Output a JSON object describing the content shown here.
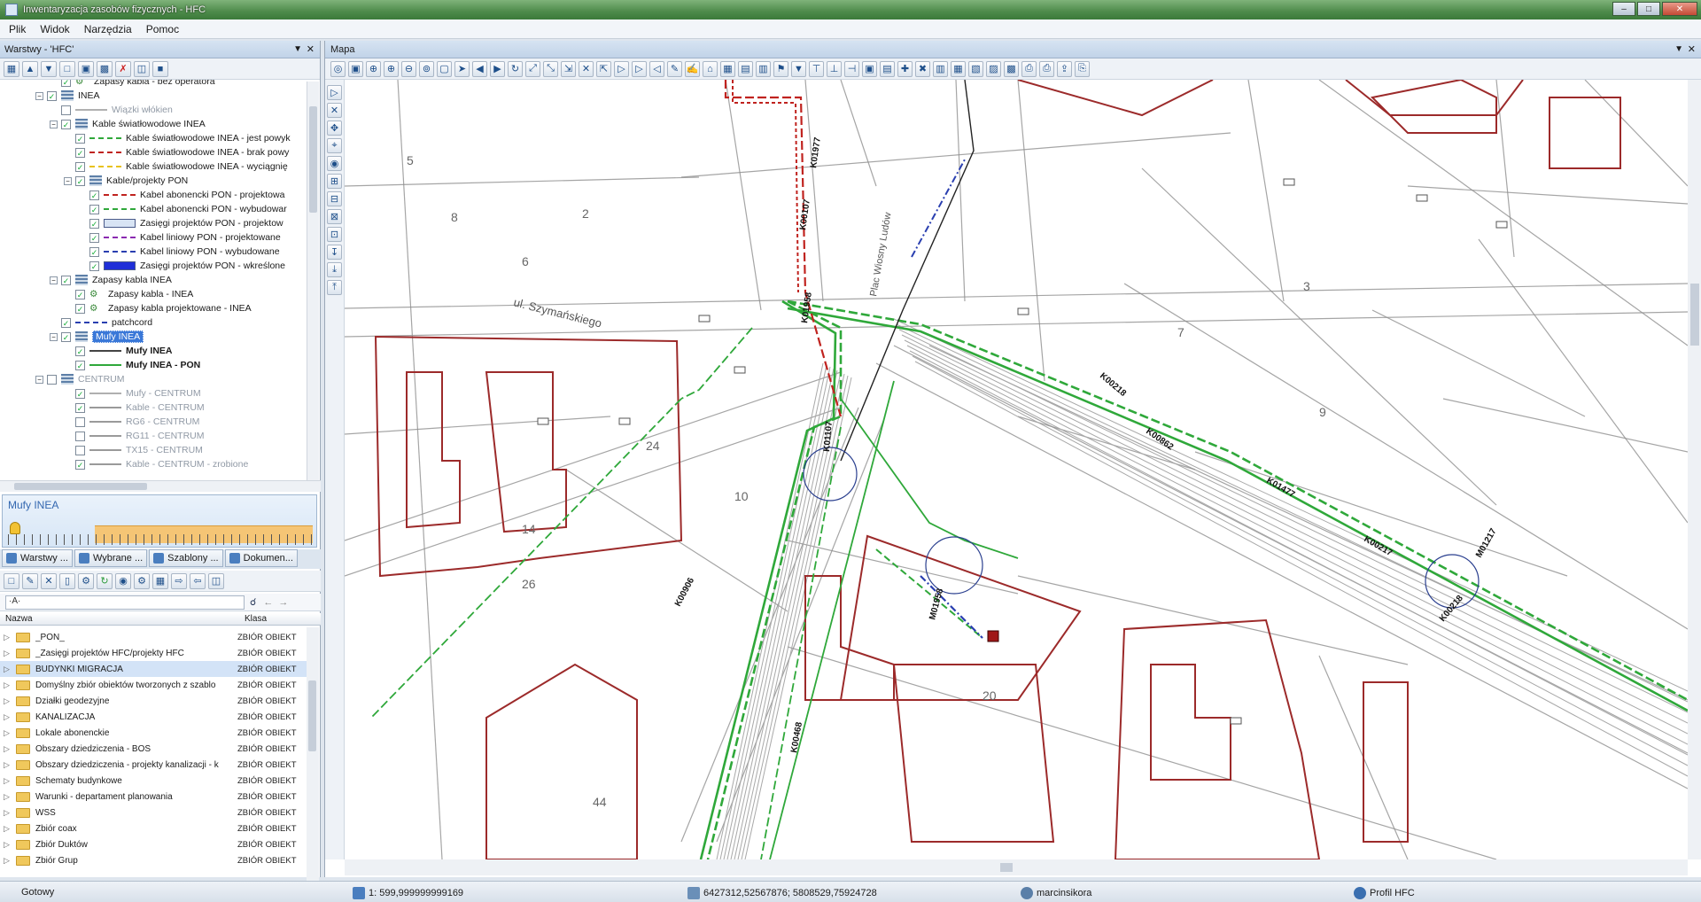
{
  "window": {
    "title": "Inwentaryzacja zasobów fizycznych - HFC"
  },
  "menu": [
    "Plik",
    "Widok",
    "Narzędzia",
    "Pomoc"
  ],
  "layers_panel": {
    "title": "Warstwy - 'HFC'",
    "items": [
      {
        "label": "Zapasy kabla - bez operatora",
        "level": 3,
        "type": "layer",
        "checked": true,
        "grey": false
      },
      {
        "label": "INEA",
        "level": 2,
        "type": "group",
        "checked": true,
        "grey": false
      },
      {
        "label": "Wiązki włókien",
        "level": 3,
        "type": "layer",
        "checked": false,
        "grey": true,
        "sym": "#b0b0b0",
        "dash": "solid"
      },
      {
        "label": "Kable światłowodowe INEA",
        "level": 3,
        "type": "group",
        "checked": true,
        "grey": false
      },
      {
        "label": "Kable światłowodowe INEA - jest powyk",
        "level": 4,
        "type": "layer",
        "checked": true,
        "grey": false,
        "sym": "#2fa83a",
        "dash": "dashed"
      },
      {
        "label": "Kable światłowodowe INEA - brak powy",
        "level": 4,
        "type": "layer",
        "checked": true,
        "grey": false,
        "sym": "#c0231f",
        "dash": "dashed"
      },
      {
        "label": "Kable światłowodowe INEA - wyciągnię",
        "level": 4,
        "type": "layer",
        "checked": true,
        "grey": false,
        "sym": "#e8c21c",
        "dash": "dashed"
      },
      {
        "label": "Kable/projekty PON",
        "level": 4,
        "type": "group",
        "checked": true,
        "grey": false
      },
      {
        "label": "Kabel abonencki PON - projektowa",
        "level": 5,
        "type": "layer",
        "checked": true,
        "grey": false,
        "sym": "#c0231f",
        "dash": "dashed"
      },
      {
        "label": "Kabel abonencki PON - wybudowar",
        "level": 5,
        "type": "layer",
        "checked": true,
        "grey": false,
        "sym": "#2fa83a",
        "dash": "dashed"
      },
      {
        "label": "Zasięgi projektów PON - projektow",
        "level": 5,
        "type": "layer",
        "checked": true,
        "grey": false,
        "sym": "#d8e4f4",
        "dash": "fill"
      },
      {
        "label": "Kabel liniowy PON - projektowane",
        "level": 5,
        "type": "layer",
        "checked": true,
        "grey": false,
        "sym": "#8a2ab0",
        "dash": "dashed"
      },
      {
        "label": "Kabel liniowy PON - wybudowane",
        "level": 5,
        "type": "layer",
        "checked": true,
        "grey": false,
        "sym": "#2a3fb0",
        "dash": "dashed"
      },
      {
        "label": "Zasięgi projektów PON - wkreślone",
        "level": 5,
        "type": "layer",
        "checked": true,
        "grey": false,
        "sym": "#1f2fd8",
        "dash": "fill"
      },
      {
        "label": "Zapasy kabla INEA",
        "level": 3,
        "type": "group",
        "checked": true,
        "grey": false
      },
      {
        "label": "Zapasy kabla - INEA",
        "level": 4,
        "type": "layer",
        "checked": true,
        "grey": false
      },
      {
        "label": "Zapasy kabla projektowane - INEA",
        "level": 4,
        "type": "layer",
        "checked": true,
        "grey": false
      },
      {
        "label": "patchcord",
        "level": 3,
        "type": "layer",
        "checked": true,
        "grey": false,
        "sym": "#2a3fb0",
        "dash": "dashdot"
      },
      {
        "label": "Mufy INEA",
        "level": 3,
        "type": "group",
        "checked": true,
        "grey": false,
        "selected": true
      },
      {
        "label": "Mufy INEA",
        "level": 4,
        "type": "layer",
        "checked": true,
        "grey": false,
        "bold": true,
        "sym": "#444444",
        "dash": "solid"
      },
      {
        "label": "Mufy INEA - PON",
        "level": 4,
        "type": "layer",
        "checked": true,
        "grey": false,
        "bold": true,
        "sym": "#2fa83a",
        "dash": "solid"
      },
      {
        "label": "CENTRUM",
        "level": 2,
        "type": "group",
        "checked": false,
        "grey": true
      },
      {
        "label": "Mufy - CENTRUM",
        "level": 4,
        "type": "layer",
        "checked": true,
        "grey": true,
        "sym": "#b0b0b0",
        "dash": "solid"
      },
      {
        "label": "Kable - CENTRUM",
        "level": 4,
        "type": "layer",
        "checked": true,
        "grey": true,
        "sym": "#9a9a9a",
        "dash": "solid"
      },
      {
        "label": "RG6 - CENTRUM",
        "level": 4,
        "type": "layer",
        "checked": false,
        "grey": true,
        "sym": "#9a9a9a",
        "dash": "solid"
      },
      {
        "label": "RG11 - CENTRUM",
        "level": 4,
        "type": "layer",
        "checked": false,
        "grey": true,
        "sym": "#9a9a9a",
        "dash": "solid"
      },
      {
        "label": "TX15 - CENTRUM",
        "level": 4,
        "type": "layer",
        "checked": false,
        "grey": true,
        "sym": "#9a9a9a",
        "dash": "solid"
      },
      {
        "label": "Kable - CENTRUM - zrobione",
        "level": 4,
        "type": "layer",
        "checked": true,
        "grey": true,
        "sym": "#9a9a9a",
        "dash": "solid"
      }
    ]
  },
  "scale_widget": {
    "title": "Mufy INEA"
  },
  "bottom_tabs": [
    "Warstwy ...",
    "Wybrane ...",
    "Szablony ...",
    "Dokumen..."
  ],
  "filter": {
    "value": "·A·"
  },
  "list": {
    "columns": [
      "Nazwa",
      "Klasa"
    ],
    "rows": [
      {
        "name": "_PON_",
        "class": "ZBIÓR OBIEKT"
      },
      {
        "name": "_Zasięgi projektów HFC/projekty HFC",
        "class": "ZBIÓR OBIEKT"
      },
      {
        "name": "BUDYNKI MIGRACJA",
        "class": "ZBIÓR OBIEKT",
        "selected": true
      },
      {
        "name": "Domyślny zbiór obiektów tworzonych z szablo",
        "class": "ZBIÓR OBIEKT"
      },
      {
        "name": "Działki geodezyjne",
        "class": "ZBIÓR OBIEKT"
      },
      {
        "name": "KANALIZACJA",
        "class": "ZBIÓR OBIEKT"
      },
      {
        "name": "Lokale abonenckie",
        "class": "ZBIÓR OBIEKT"
      },
      {
        "name": "Obszary dziedziczenia - BOS",
        "class": "ZBIÓR OBIEKT"
      },
      {
        "name": "Obszary dziedziczenia - projekty kanalizacji - k",
        "class": "ZBIÓR OBIEKT"
      },
      {
        "name": "Schematy budynkowe",
        "class": "ZBIÓR OBIEKT"
      },
      {
        "name": "Warunki - departament planowania",
        "class": "ZBIÓR OBIEKT"
      },
      {
        "name": "WSS",
        "class": "ZBIÓR OBIEKT"
      },
      {
        "name": "Zbiór coax",
        "class": "ZBIÓR OBIEKT"
      },
      {
        "name": "Zbiór Duktów",
        "class": "ZBIÓR OBIEKT"
      },
      {
        "name": "Zbiór Grup",
        "class": "ZBIÓR OBIEKT"
      }
    ]
  },
  "map": {
    "title": "Mapa",
    "street_labels": [
      "ul. Szymańskiego",
      "Plac Wiosny Ludów"
    ],
    "cable_labels": [
      "K00107",
      "K01977",
      "K01958",
      "K00218",
      "K00862",
      "K01477",
      "K01107",
      "K00906",
      "K00217",
      "K00218",
      "K00468"
    ],
    "closure_labels": [
      "M01958",
      "M01217"
    ],
    "parcel_numbers": [
      "2",
      "3",
      "5",
      "6",
      "7",
      "8",
      "9",
      "10",
      "14",
      "20",
      "24",
      "26",
      "44"
    ],
    "colors": {
      "fiber_green": "#2fa83a",
      "fiber_red": "#c0231f",
      "parcel_red": "#9c2a2a",
      "base_grey": "#8f8f8f",
      "patch_blue": "#2a3fb0"
    }
  },
  "status": {
    "ready": "Gotowy",
    "scale": "1: 599,999999999169",
    "coords": "6427312,52567876; 5808529,75924728",
    "user": "marcinsikora",
    "profile": "Profil HFC"
  }
}
